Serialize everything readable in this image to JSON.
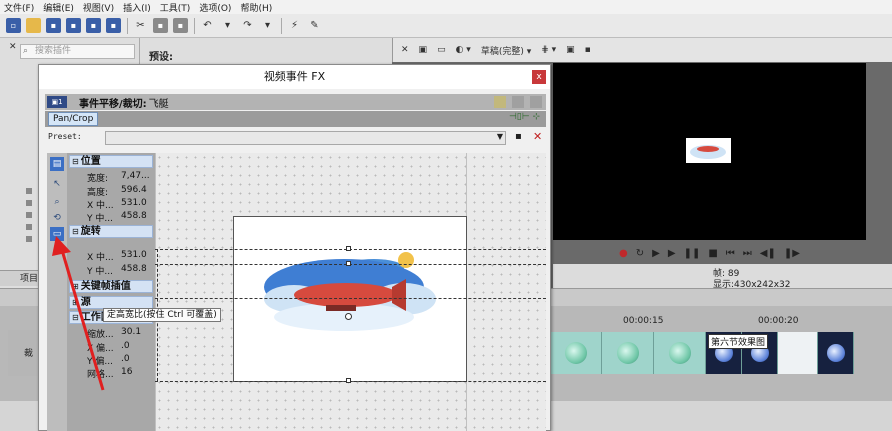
{
  "menu": [
    "文件(F)",
    "编辑(E)",
    "视图(V)",
    "插入(I)",
    "工具(T)",
    "选项(O)",
    "帮助(H)"
  ],
  "left": {
    "search_placeholder": "搜索插件",
    "project_tab": "项目"
  },
  "preset_panel": {
    "label": "预设:"
  },
  "preview": {
    "quality": "草稿(完整)",
    "frame_label": "帧:",
    "frame_value": "89",
    "display_label": "显示:",
    "display_value": "430x242x32"
  },
  "timeline": {
    "tc1": "00:00:15",
    "tc2": "00:00:20",
    "clip_label": "第六节效果图",
    "track_label": "裁"
  },
  "dialog": {
    "title": "视频事件 FX",
    "close": "x",
    "fx_title": "事件平移/裁切:",
    "fx_event": "飞艇",
    "fx_icon": "▣1",
    "tab": "Pan/Crop",
    "preset_label": "Preset:",
    "tooltip": "定高宽比(按住 Ctrl 可覆盖)",
    "sections": {
      "position": {
        "label": "位置",
        "rows": [
          {
            "k": "宽度:",
            "v": "7,47..."
          },
          {
            "k": "高度:",
            "v": "596.4"
          },
          {
            "k": "X 中...",
            "v": "531.0"
          },
          {
            "k": "Y 中...",
            "v": "458.8"
          }
        ]
      },
      "rotation": {
        "label": "旋转",
        "rows": [
          {
            "k": "X 中...",
            "v": "531.0"
          },
          {
            "k": "Y 中...",
            "v": "458.8"
          }
        ]
      },
      "keyframe": {
        "label": "关键帧插值"
      },
      "source": {
        "label": "源"
      },
      "workspace": {
        "label": "工作区",
        "rows": [
          {
            "k": "缩放...",
            "v": "30.1"
          },
          {
            "k": "X 偏...",
            "v": ".0"
          },
          {
            "k": "Y 偏...",
            "v": ".0"
          },
          {
            "k": "网格...",
            "v": "16"
          }
        ]
      }
    }
  },
  "colors": {
    "accent": "#3b6fc4",
    "close_red": "#c8383a",
    "airship_red": "#d64a3e",
    "cloud_blue": "#4a8fd8"
  }
}
